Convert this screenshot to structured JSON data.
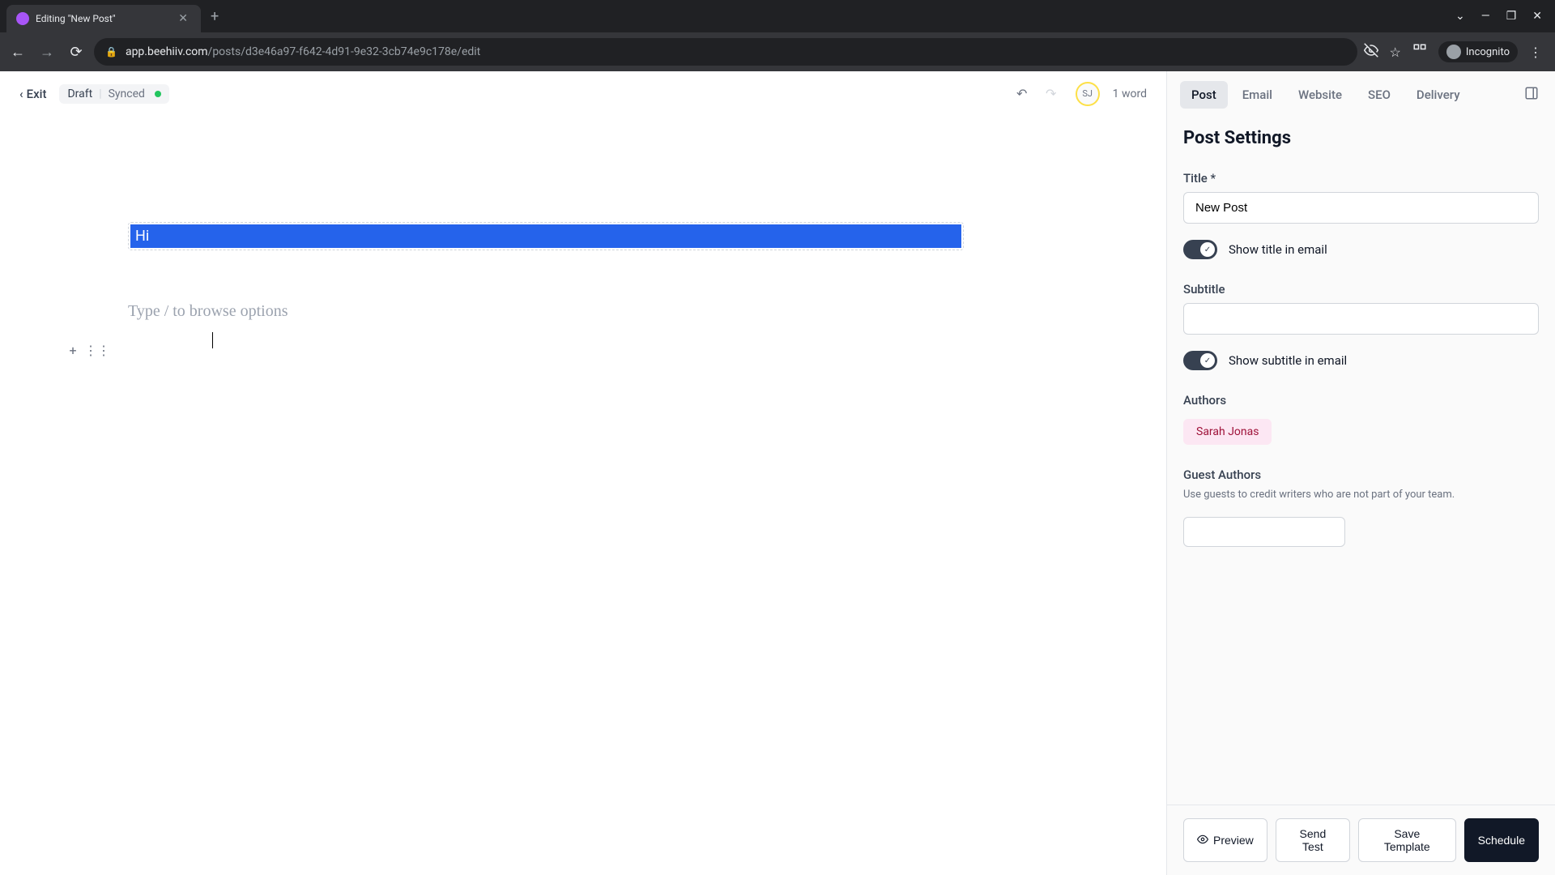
{
  "browser": {
    "tab_title": "Editing \"New Post\"",
    "url_domain": "app.beehiiv.com",
    "url_path": "/posts/d3e46a97-f642-4d91-9e32-3cb74e9c178e/edit",
    "incognito_label": "Incognito"
  },
  "header": {
    "exit_label": "Exit",
    "draft_label": "Draft",
    "sync_label": "Synced",
    "avatar_initials": "SJ",
    "word_count": "1 word"
  },
  "editor": {
    "content_text": "Hi",
    "placeholder": "Type  /  to browse options"
  },
  "sidebar": {
    "tabs": {
      "post": "Post",
      "email": "Email",
      "website": "Website",
      "seo": "SEO",
      "delivery": "Delivery"
    },
    "title": "Post Settings",
    "title_label": "Title *",
    "title_value": "New Post",
    "show_title_label": "Show title in email",
    "subtitle_label": "Subtitle",
    "subtitle_value": "",
    "show_subtitle_label": "Show subtitle in email",
    "authors_label": "Authors",
    "author_name": "Sarah Jonas",
    "guest_label": "Guest Authors",
    "guest_help": "Use guests to credit writers who are not part of your team."
  },
  "footer": {
    "preview": "Preview",
    "send_test": "Send Test",
    "save_template": "Save Template",
    "schedule": "Schedule"
  }
}
